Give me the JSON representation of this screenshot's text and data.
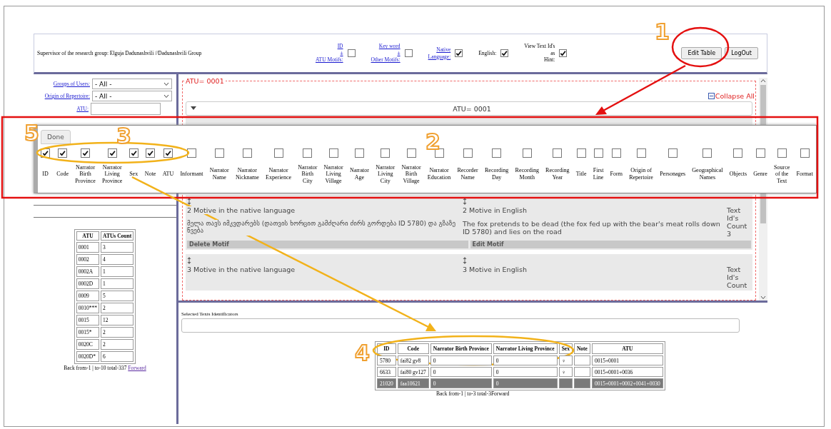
{
  "header": {
    "supervisor": "Supervisor of the research group: Elguja Dadunashvili //Dadunashvili Group",
    "filters": [
      {
        "lines": [
          "ID",
          "±",
          "ATU Motifs:"
        ],
        "kind": "link",
        "checked": false
      },
      {
        "lines": [
          "Key word",
          "±",
          "Other Motifs:"
        ],
        "kind": "link",
        "checked": false
      },
      {
        "lines": [
          "Native",
          "Language:"
        ],
        "kind": "link",
        "checked": true
      },
      {
        "lines": [
          "English:"
        ],
        "kind": "plain",
        "checked": true
      },
      {
        "lines": [
          "View Text Id's",
          "as",
          "Hint:"
        ],
        "kind": "plain",
        "checked": true
      }
    ],
    "buttons": [
      "Edit Table",
      "LogOut"
    ]
  },
  "sidebar": {
    "filters": [
      {
        "label": "Groups of Users:",
        "kind": "select",
        "value": "- All -"
      },
      {
        "label": "Origin of Repertoire:",
        "kind": "select",
        "value": "- All -"
      },
      {
        "label": "ATU:",
        "kind": "input"
      }
    ],
    "atu_table": {
      "columns": [
        "ATU",
        "ATUs Count"
      ],
      "rows": [
        [
          "0001",
          "3"
        ],
        [
          "0002",
          "4"
        ],
        [
          "0002A",
          "1"
        ],
        [
          "0002D",
          "1"
        ],
        [
          "0009",
          "5"
        ],
        [
          "0010***",
          "2"
        ],
        [
          "0015",
          "12"
        ],
        [
          "0015*",
          "2"
        ],
        [
          "0020C",
          "2"
        ],
        [
          "0020D*",
          "6"
        ]
      ]
    },
    "pager": {
      "text": "Back from-1 | to-10 total-337",
      "link": "Forward"
    }
  },
  "motifs": {
    "title": "ATU= 0001",
    "collapse": "Collapse All",
    "group_header": "ATU= 0001",
    "items": [
      {
        "native_label": "2 Motive in the native language",
        "english_label": "2 Motive in English",
        "count": "Text Id's Count 3",
        "native_text": "მელა თავს იმკვდარებს (დათვის ხორცით გამძღარი ძირს გორდება ID 5780) და გზაზე წვება",
        "english_text": "The fox pretends to be dead (the fox fed up with the bear's meat rolls down ID 5780) and lies on the road",
        "buttons": [
          "Delete Motif",
          "Edit Motif"
        ]
      },
      {
        "native_label": "3 Motive in the native language",
        "english_label": "3 Motive in English",
        "count": "Text Id's Count"
      }
    ]
  },
  "selected": {
    "label": "Selected Texts Identificators",
    "table": {
      "columns": [
        "ID",
        "Code",
        "Narrator Birth Province",
        "Narrator Living Province",
        "Sex",
        "Note",
        "ATU"
      ],
      "rows": [
        {
          "cells": [
            "5780",
            "fai82 gv8",
            "0",
            "0",
            "♀",
            "",
            "0015+0001"
          ],
          "selected": false
        },
        {
          "cells": [
            "6633",
            "fai80 gv127",
            "0",
            "0",
            "♀",
            "",
            "0015+0001+0036"
          ],
          "selected": false
        },
        {
          "cells": [
            "21020",
            "faa10621",
            "0",
            "0",
            "",
            "",
            "0015+0001+0002+0041+0030"
          ],
          "selected": true
        }
      ]
    },
    "pager": "Back from-1 | to-3 total-3Forward"
  },
  "column_editor": {
    "done": "Done",
    "columns": [
      {
        "label": "ID",
        "checked": true
      },
      {
        "label": "Code",
        "checked": true
      },
      {
        "label": "Narrator Birth Province",
        "checked": true
      },
      {
        "label": "Narrator Living Province",
        "checked": true
      },
      {
        "label": "Sex",
        "checked": true
      },
      {
        "label": "Note",
        "checked": true
      },
      {
        "label": "ATU",
        "checked": true
      },
      {
        "label": "Informant",
        "checked": false
      },
      {
        "label": "Narrator Name",
        "checked": false
      },
      {
        "label": "Narrator Nickname",
        "checked": false
      },
      {
        "label": "Narrator Experience",
        "checked": false
      },
      {
        "label": "Narrator Birth City",
        "checked": false
      },
      {
        "label": "Narrator Living Village",
        "checked": false
      },
      {
        "label": "Narrator Age",
        "checked": false
      },
      {
        "label": "Narrator Living City",
        "checked": false
      },
      {
        "label": "Narrator Birth Village",
        "checked": false
      },
      {
        "label": "Narrator Education",
        "checked": false
      },
      {
        "label": "Recorder Name",
        "checked": false
      },
      {
        "label": "Recording Day",
        "checked": false
      },
      {
        "label": "Recording Month",
        "checked": false
      },
      {
        "label": "Recording Year",
        "checked": false
      },
      {
        "label": "Title",
        "checked": false
      },
      {
        "label": "First Line",
        "checked": false
      },
      {
        "label": "Form",
        "checked": false
      },
      {
        "label": "Origin of Repertoire",
        "checked": false
      },
      {
        "label": "Personages",
        "checked": false
      },
      {
        "label": "Geographical Names",
        "checked": false
      },
      {
        "label": "Objects",
        "checked": false
      },
      {
        "label": "Genre",
        "checked": false
      },
      {
        "label": "Source of the Text",
        "checked": false
      },
      {
        "label": "Format",
        "checked": false
      }
    ]
  },
  "annotations": {
    "callouts": [
      "1",
      "5",
      "3",
      "2",
      "4"
    ]
  }
}
